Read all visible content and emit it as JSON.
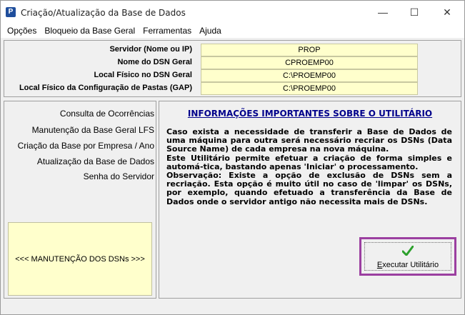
{
  "window": {
    "title": "Criação/Atualização da Base de Dados",
    "icon_letter": "P",
    "controls": {
      "minimize": "—",
      "maximize": "☐",
      "close": "✕"
    }
  },
  "menu": [
    "Opções",
    "Bloqueio da Base Geral",
    "Ferramentas",
    "Ajuda"
  ],
  "server_info": [
    {
      "label": "Servidor (Nome ou IP)",
      "value": "PROP"
    },
    {
      "label": "Nome do DSN Geral",
      "value": "CPROEMP00"
    },
    {
      "label": "Local Físico no DSN Geral",
      "value": "C:\\PROEMP00"
    },
    {
      "label": "Local Físico da Configuração de Pastas (GAP)",
      "value": "C:\\PROEMP00"
    }
  ],
  "nav": {
    "items": [
      "Consulta de Ocorrências",
      "Manutenção da Base Geral LFS",
      "Criação da Base por Empresa / Ano",
      "Atualização da Base de Dados",
      "Senha do Servidor"
    ],
    "dsn_button": "<<<  MANUTENÇÃO DOS DSNs  >>>"
  },
  "main": {
    "title": "INFORMAÇÕES IMPORTANTES SOBRE O UTILITÁRIO",
    "paragraphs": [
      " Caso exista a necessidade de transferir a Base de Dados de uma máquina para outra será necessário recriar os DSNs (Data Source Name) de cada empresa na nova máquina.",
      " Este Utilitário permite efetuar  a  criação de forma simples e automá-tica, bastando apenas 'Iniciar' o processamento.",
      " Observação: Existe a opção de exclusão de DSNs sem a recriação. Esta opção é muito útil no  caso  de  'limpar' os  DSNs,  por exemplo, quando  efetuado a transferência da Base de Dados onde o servidor antigo não necessita mais de  DSNs."
    ],
    "run_button": "Executar Utilitário"
  },
  "colors": {
    "accent": "#00008b",
    "highlight": "#9b3fa0",
    "field_bg": "#ffffcc",
    "check": "#2ca02c"
  }
}
